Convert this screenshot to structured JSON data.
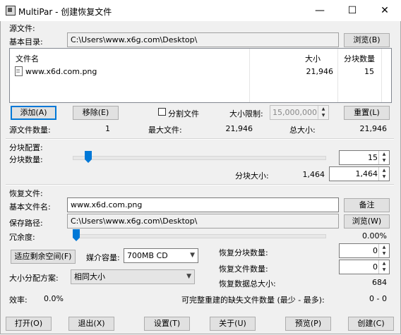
{
  "window": {
    "title": "MultiPar - 创建恢复文件",
    "minimize": "—",
    "maximize": "☐",
    "close": "✕"
  },
  "source": {
    "group_label": "源文件:",
    "base_dir_label": "基本目录:",
    "base_dir_value": "C:\\Users\\www.x6g.com\\Desktop\\",
    "browse_label": "浏览(B)",
    "list": {
      "headers": [
        "文件名",
        "大小",
        "分块数量"
      ],
      "rows": [
        {
          "name": "www.x6d.com.png",
          "size": "21,946",
          "blocks": "15"
        }
      ]
    },
    "add_label": "添加(A)",
    "remove_label": "移除(E)",
    "split_label": "分割文件",
    "size_limit_label": "大小限制:",
    "size_limit_value": "15,000,000",
    "reset_label": "重置(L)",
    "count_label": "源文件数量:",
    "count_value": "1",
    "max_file_label": "最大文件:",
    "max_file_value": "21,946",
    "total_label": "总大小:",
    "total_value": "21,946"
  },
  "block": {
    "group_label": "分块配置:",
    "count_label": "分块数量:",
    "count_value": "15",
    "count_slider_level": 0.05,
    "size_label": "分块大小:",
    "size_text": "1,464",
    "size_value": "1,464"
  },
  "recovery": {
    "group_label": "恢复文件:",
    "base_name_label": "基本文件名:",
    "base_name_value": "www.x6d.com.png",
    "comment_label": "备注",
    "save_path_label": "保存路径:",
    "save_path_value": "C:\\Users\\www.x6g.com\\Desktop\\",
    "browse_label": "浏览(W)",
    "redundancy_label": "冗余度:",
    "redundancy_value": "0.00%",
    "redundancy_level": 0.0,
    "fit_label": "适应剩余空间(F)",
    "media_label": "媒介容量:",
    "media_value": "700MB CD",
    "size_scheme_label": "大小分配方案:",
    "size_scheme_value": "相同大小",
    "recovery_blocks_label": "恢复分块数量:",
    "recovery_blocks_value": "0",
    "recovery_files_label": "恢复文件数量:",
    "recovery_files_value": "0",
    "recovery_total_label": "恢复数据总大小:",
    "recovery_total_value": "684",
    "efficiency_label": "效率:",
    "efficiency_value": "0.0%",
    "missing_label": "可完整重建的缺失文件数量 (最少 - 最多):",
    "missing_value": "0 - 0"
  },
  "footer": {
    "open": "打开(O)",
    "exit": "退出(X)",
    "settings": "设置(T)",
    "about": "关于(U)",
    "preview": "预览(P)",
    "create": "创建(C)"
  }
}
